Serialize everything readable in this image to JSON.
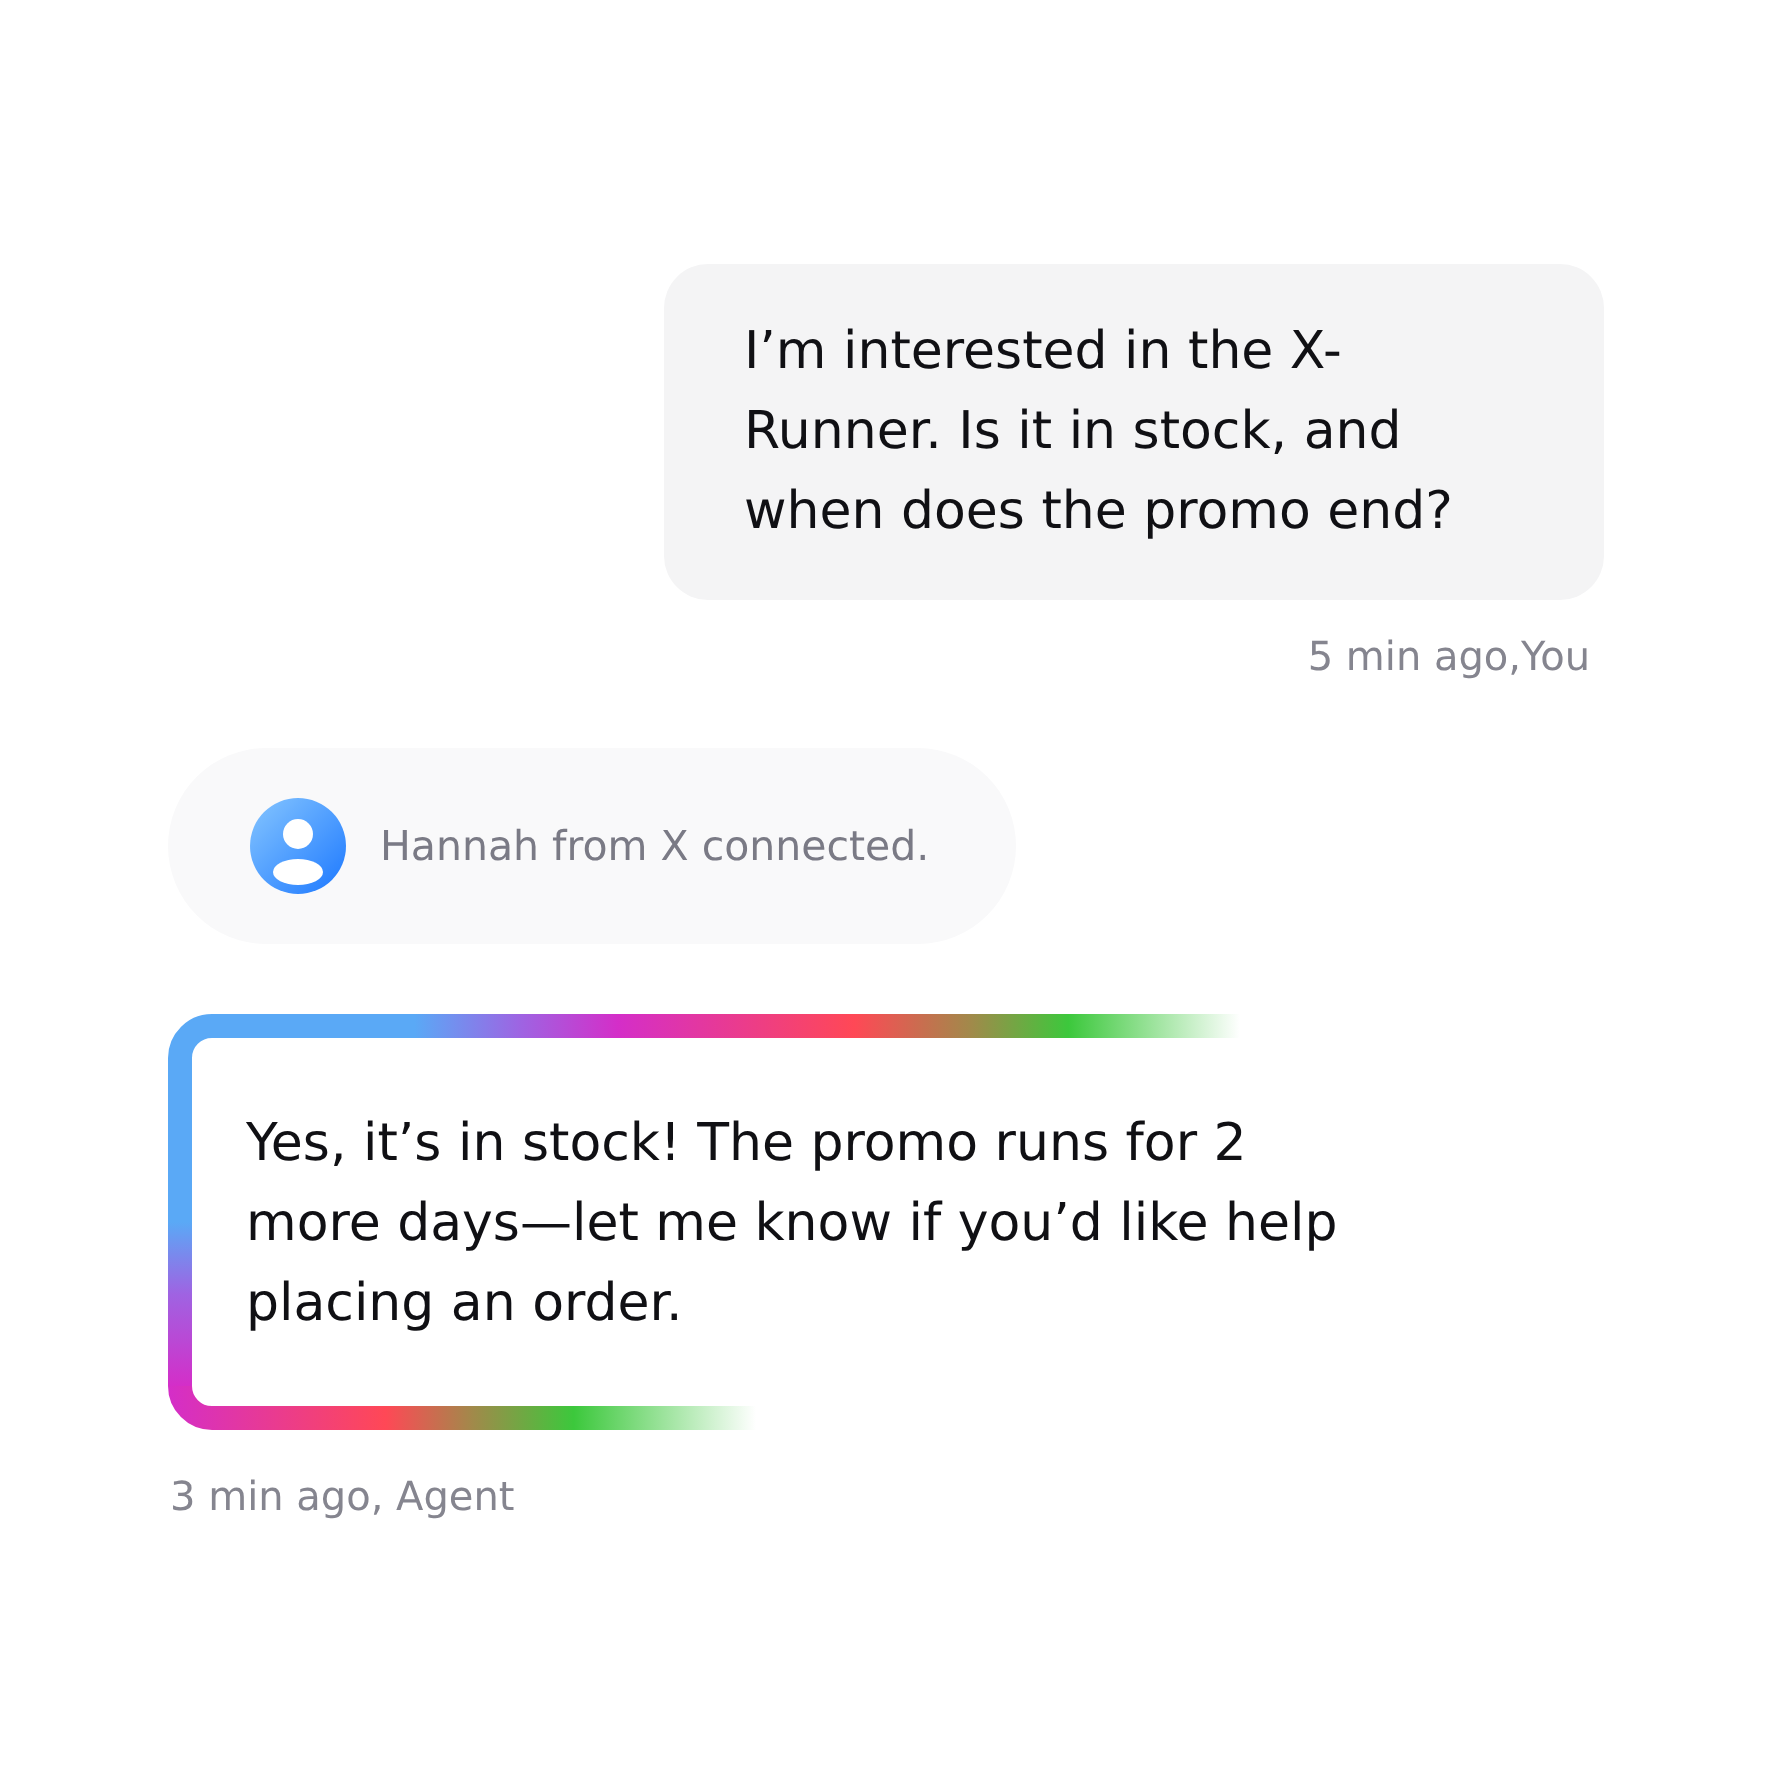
{
  "messages": [
    {
      "kind": "user",
      "text": "I’m interested in the X-Runner. Is it in stock, and when does the promo end?",
      "meta": "5 min ago,You"
    },
    {
      "kind": "system",
      "text": "Hannah from X connected."
    },
    {
      "kind": "agent",
      "text": "Yes, it’s in stock! The promo runs for 2 more days—let me know if you’d like help placing an order.",
      "meta": "3 min ago, Agent"
    }
  ]
}
